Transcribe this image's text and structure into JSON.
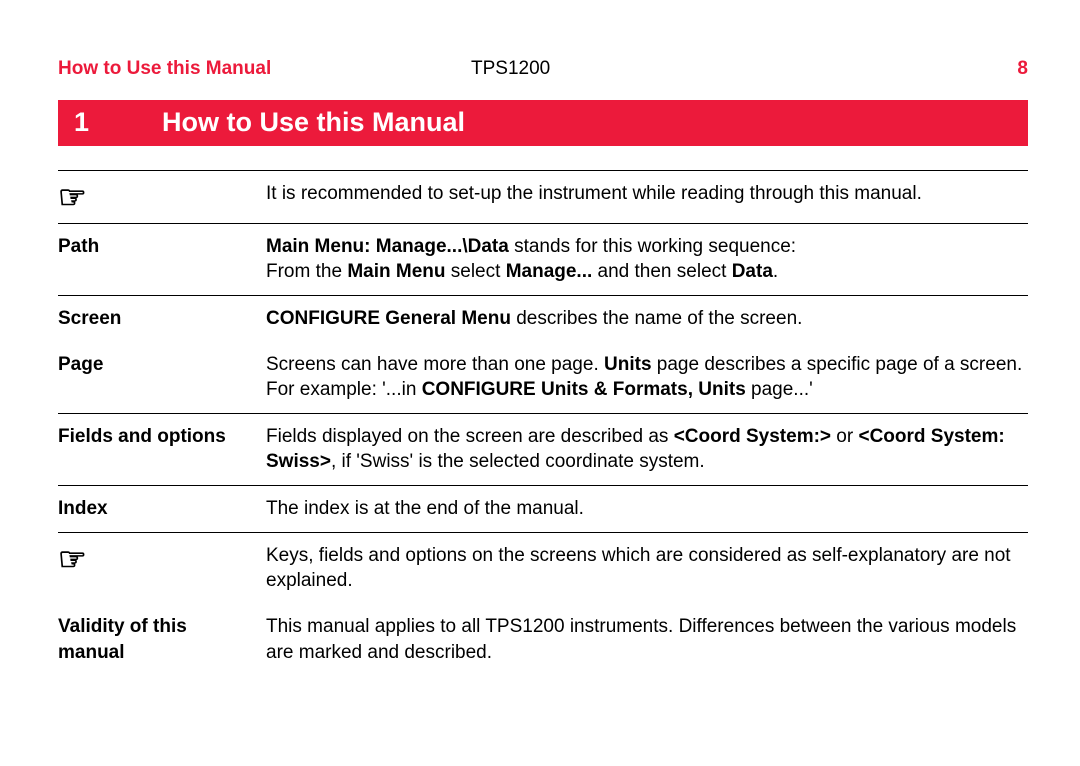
{
  "header": {
    "left": "How to Use this Manual",
    "center": "TPS1200",
    "page_number": "8"
  },
  "chapter": {
    "number": "1",
    "title": "How to Use this Manual"
  },
  "rows": {
    "intro": {
      "icon": "☞",
      "text": "It is recommended to set-up the instrument while reading through this manual."
    },
    "path": {
      "label": "Path",
      "line1_prefix": "Main Menu: Manage...\\Data",
      "line1_rest": " stands for this working sequence:",
      "line2_a": "From the ",
      "line2_b": "Main Menu",
      "line2_c": " select ",
      "line2_d": "Manage...",
      "line2_e": " and then select ",
      "line2_f": "Data",
      "line2_g": "."
    },
    "screen": {
      "label": "Screen",
      "bold": "CONFIGURE General Menu",
      "rest": " describes the name of the screen."
    },
    "page": {
      "label": "Page",
      "t1": "Screens can have more than one page. ",
      "t2": "Units",
      "t3": " page describes a specific page of a screen. For example: '...in ",
      "t4": "CONFIGURE Units & Formats, Units",
      "t5": " page...'"
    },
    "fields": {
      "label": "Fields and options",
      "t1": "Fields displayed on the screen are described as ",
      "t2": "<Coord System:>",
      "t3": " or ",
      "t4": "<Coord System: Swiss>",
      "t5": ", if 'Swiss' is the selected coordinate system."
    },
    "index": {
      "label": "Index",
      "text": "The index is at the end of the manual."
    },
    "note2": {
      "icon": "☞",
      "text": "Keys, fields and options on the screens which are considered as self-explanatory are not explained."
    },
    "validity": {
      "label": "Validity of this manual",
      "text": "This manual applies to all TPS1200 instruments. Differences between the various models are marked and described."
    }
  }
}
